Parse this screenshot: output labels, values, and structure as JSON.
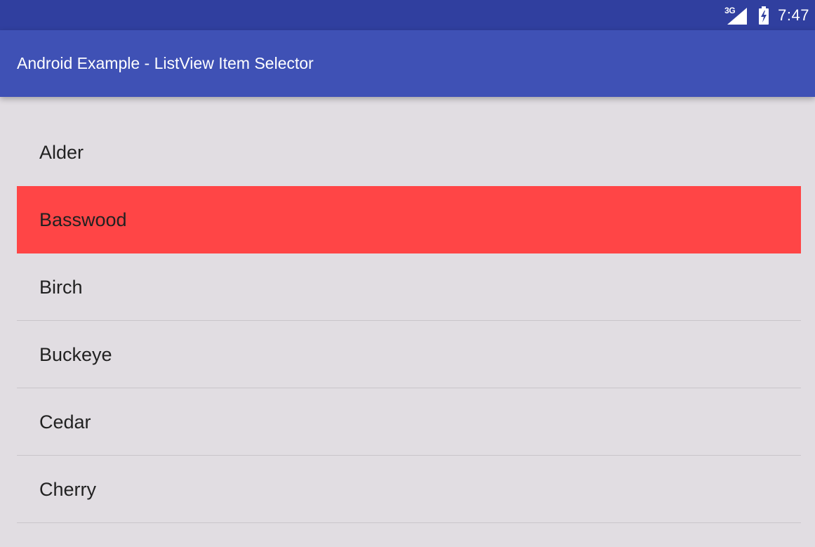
{
  "status_bar": {
    "network_type": "3G",
    "time": "7:47",
    "icons": [
      "cellular-signal-icon",
      "battery-charging-icon"
    ],
    "background_color": "#303f9f"
  },
  "app_bar": {
    "title": "Android Example - ListView Item Selector",
    "background_color": "#3f51b5"
  },
  "list": {
    "items": [
      {
        "label": "Alder",
        "selected": false
      },
      {
        "label": "Basswood",
        "selected": true
      },
      {
        "label": "Birch",
        "selected": false
      },
      {
        "label": "Buckeye",
        "selected": false
      },
      {
        "label": "Cedar",
        "selected": false
      },
      {
        "label": "Cherry",
        "selected": false
      }
    ],
    "selected_color": "#ff4546",
    "background_color": "#e1dde2"
  }
}
